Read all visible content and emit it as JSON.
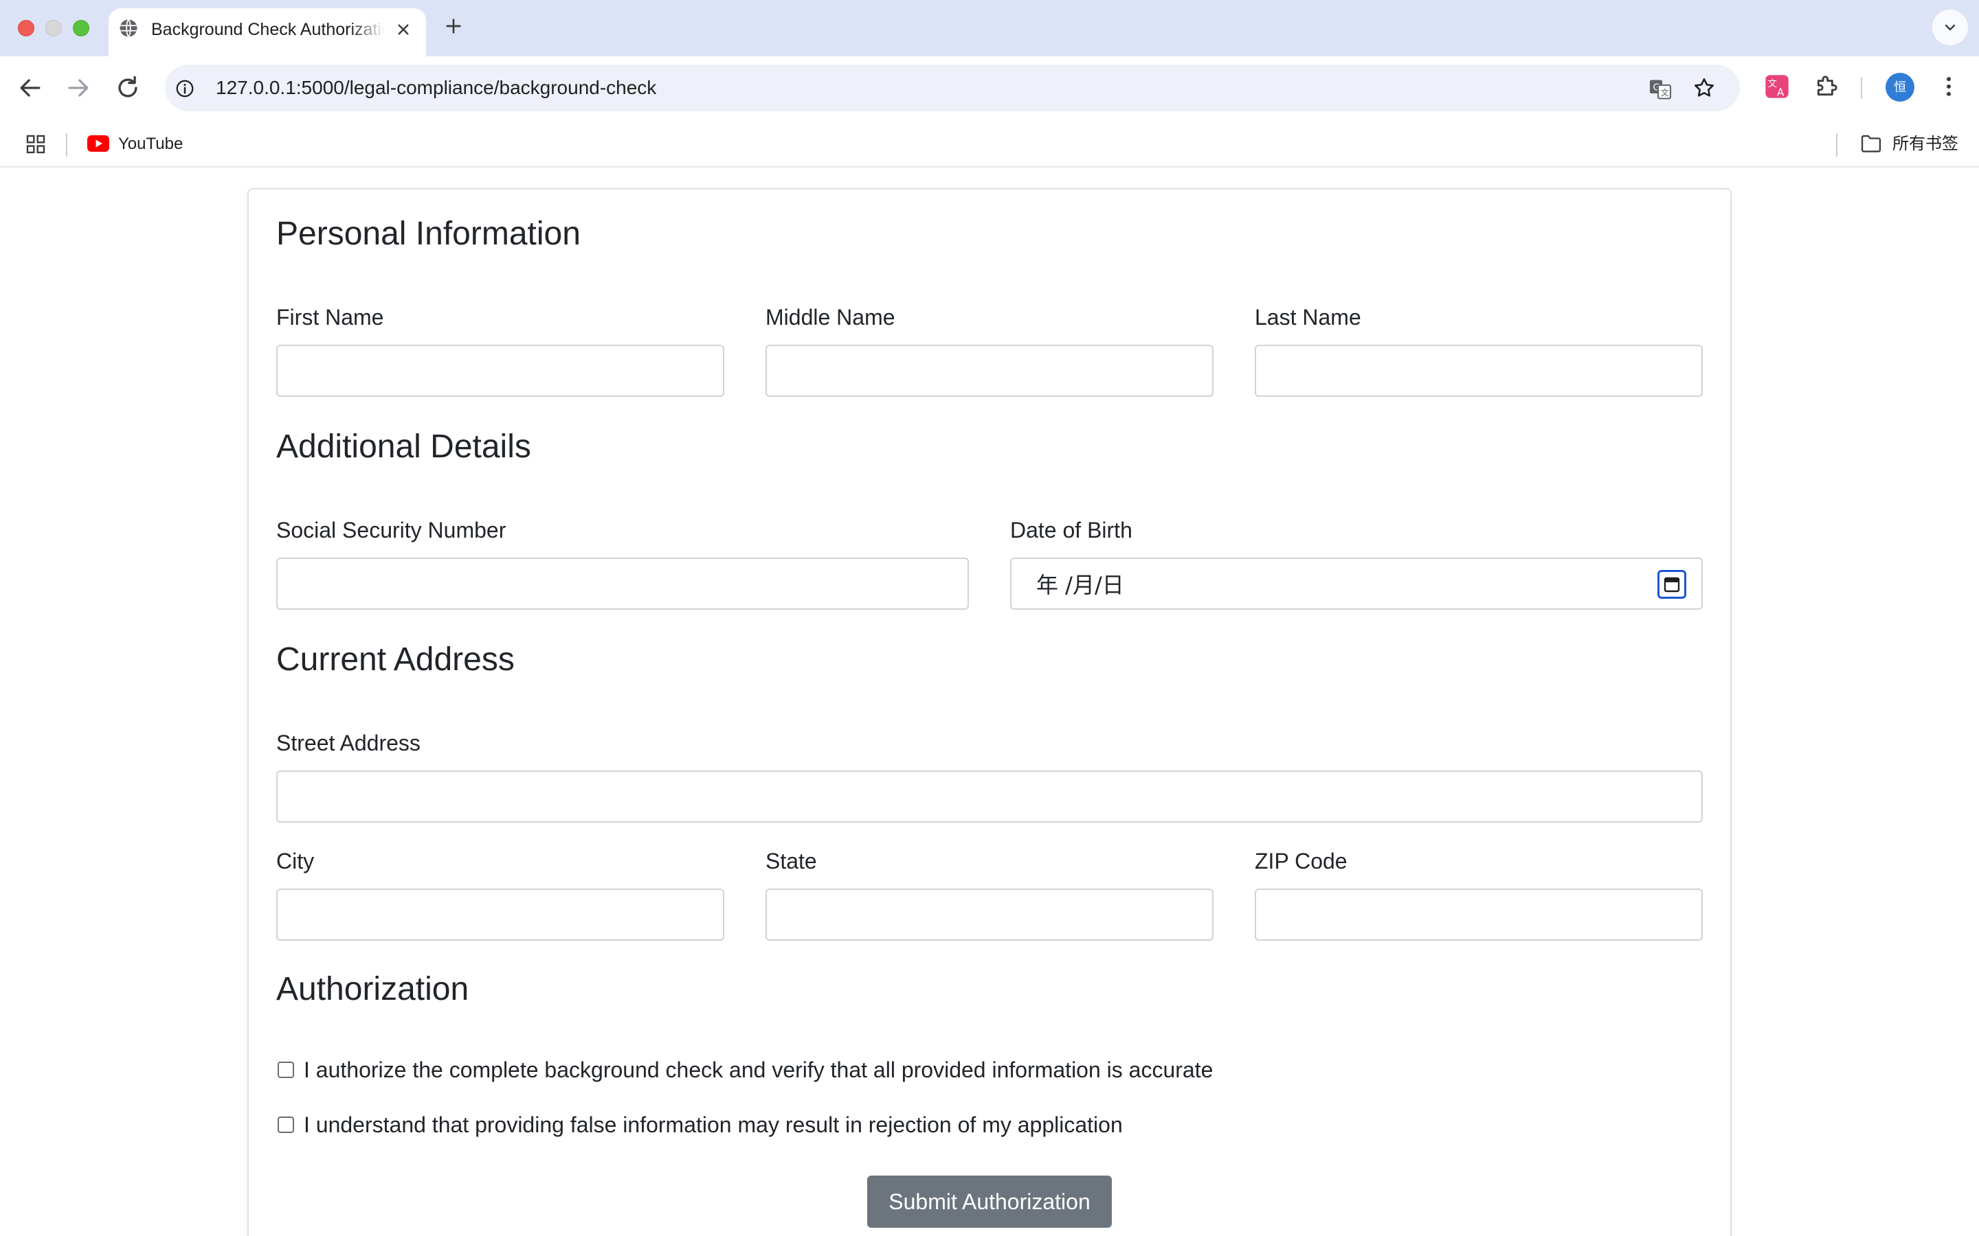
{
  "browser": {
    "tab_title": "Background Check Authorization",
    "url": "127.0.0.1:5000/legal-compliance/background-check",
    "avatar_letter": "恒",
    "bookmarks": [
      {
        "label": "YouTube",
        "icon": "youtube-icon"
      }
    ],
    "all_bookmarks_label": "所有书签",
    "icons": [
      "globe-icon",
      "close-icon",
      "plus-icon",
      "chevron-down-icon",
      "back-arrow-icon",
      "forward-arrow-icon",
      "reload-icon",
      "info-icon",
      "translate-icon",
      "star-icon",
      "translator-extension-icon",
      "puzzle-icon",
      "kebab-menu-icon",
      "apps-grid-icon",
      "folder-icon"
    ]
  },
  "form": {
    "sections": {
      "personal": "Personal Information",
      "additional": "Additional Details",
      "address": "Current Address",
      "authorization": "Authorization"
    },
    "labels": {
      "first_name": "First Name",
      "middle_name": "Middle Name",
      "last_name": "Last Name",
      "ssn": "Social Security Number",
      "dob": "Date of Birth",
      "street": "Street Address",
      "city": "City",
      "state": "State",
      "zip": "ZIP Code"
    },
    "values": {
      "first_name": "",
      "middle_name": "",
      "last_name": "",
      "ssn": "",
      "street": "",
      "city": "",
      "state": "",
      "zip": ""
    },
    "dob_placeholder": "年 /月/日",
    "checkboxes": [
      {
        "label": "I authorize the complete background check and verify that all provided information is accurate",
        "checked": false
      },
      {
        "label": "I understand that providing false information may result in rejection of my application",
        "checked": false
      }
    ],
    "submit_label": "Submit Authorization"
  },
  "colors": {
    "tabbar_bg": "#dde3f6",
    "submit_bg": "#6c757d",
    "calendar_focus": "#1a56d6"
  }
}
